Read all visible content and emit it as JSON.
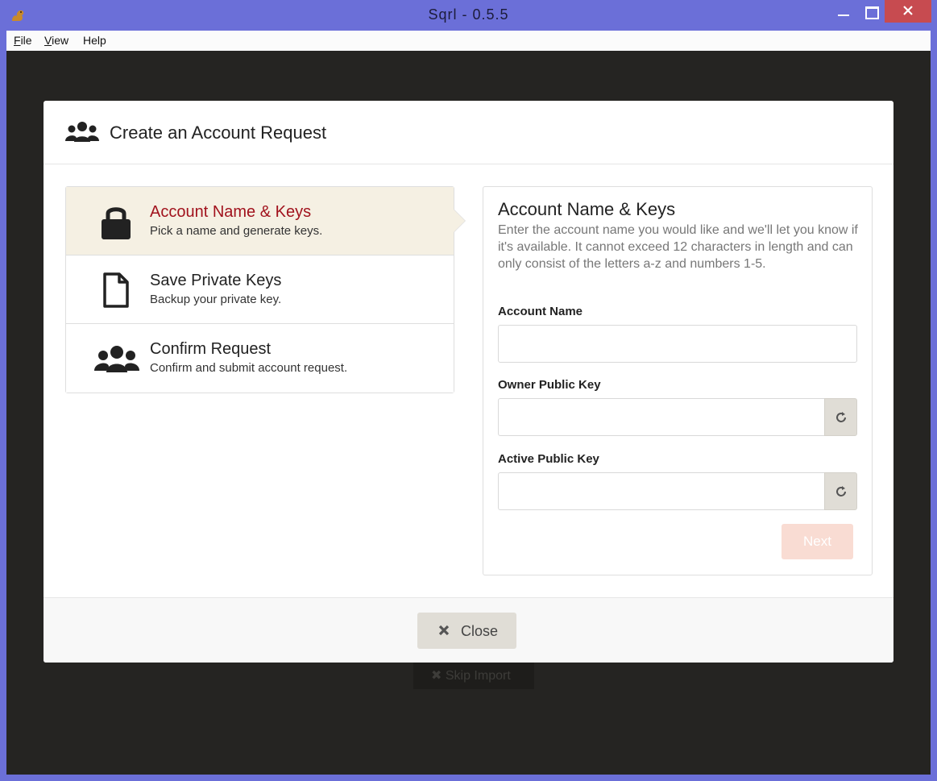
{
  "window": {
    "title": "Sqrl  -  0.5.5"
  },
  "menu": {
    "file": "ile",
    "file_key": "F",
    "view": "iew",
    "view_key": "V",
    "help": "Help"
  },
  "background": {
    "skip_import": "Skip Import"
  },
  "modal": {
    "title": "Create an Account Request",
    "steps": [
      {
        "title": "Account Name & Keys",
        "subtitle": "Pick a name and generate keys.",
        "icon": "lock-icon"
      },
      {
        "title": "Save Private Keys",
        "subtitle": "Backup your private key.",
        "icon": "file-icon"
      },
      {
        "title": "Confirm Request",
        "subtitle": "Confirm and submit account request.",
        "icon": "users-icon"
      }
    ],
    "form": {
      "title": "Account Name & Keys",
      "description": "Enter the account name you would like and we'll let you know if it's available. It cannot exceed 12 characters in length and can only consist of the letters a-z and numbers 1-5.",
      "account_name_label": "Account Name",
      "account_name_value": "",
      "owner_key_label": "Owner Public Key",
      "owner_key_value": "",
      "active_key_label": "Active Public Key",
      "active_key_value": "",
      "next_label": "Next"
    },
    "close_label": "Close"
  },
  "colors": {
    "window_frame": "#6b6fd8",
    "active_step": "#a1121d",
    "active_step_bg": "#f5f0e3",
    "next_button": "#f9dcd3"
  }
}
